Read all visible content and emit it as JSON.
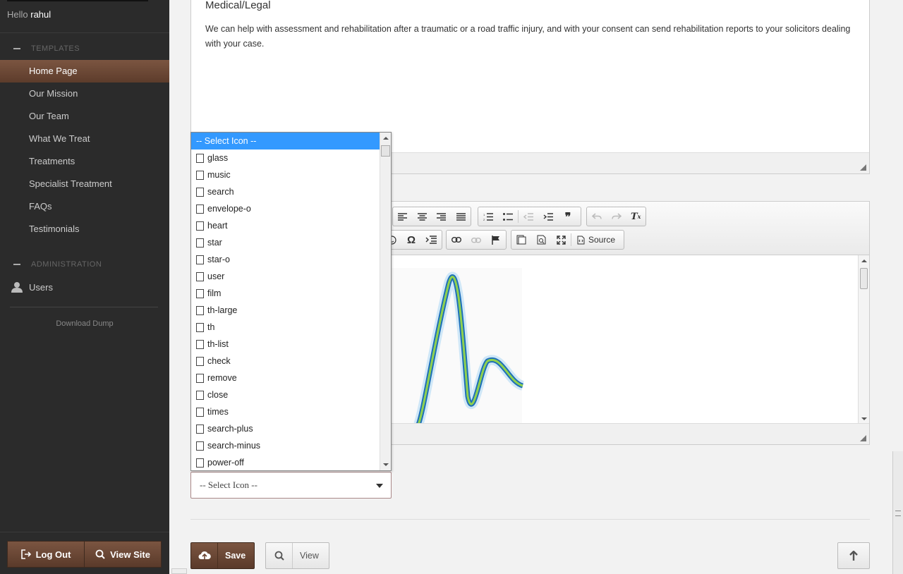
{
  "sidebar": {
    "hello_prefix": "Hello",
    "username": "rahul",
    "templates_heading": "TEMPLATES",
    "items": [
      {
        "label": "Home Page"
      },
      {
        "label": "Our Mission"
      },
      {
        "label": "Our Team"
      },
      {
        "label": "What We Treat"
      },
      {
        "label": "Treatments"
      },
      {
        "label": "Specialist Treatment"
      },
      {
        "label": "FAQs"
      },
      {
        "label": "Testimonials"
      }
    ],
    "admin_heading": "ADMINISTRATION",
    "users_label": "Users",
    "download_label": "Download Dump",
    "logout_label": "Log Out",
    "viewsite_label": "View Site"
  },
  "content": {
    "title": "Medical/Legal",
    "body": "We can help with assessment and rehabilitation after a traumatic or a road traffic injury, and with your consent can send rehabilitation reports to your solicitors dealing with your case."
  },
  "editor": {
    "source_label": "Source"
  },
  "icon_select": {
    "selected": "-- Select Icon --",
    "options": [
      "-- Select Icon --",
      "glass",
      "music",
      "search",
      "envelope-o",
      "heart",
      "star",
      "star-o",
      "user",
      "film",
      "th-large",
      "th",
      "th-list",
      "check",
      "remove",
      "close",
      "times",
      "search-plus",
      "search-minus",
      "power-off"
    ]
  },
  "actions": {
    "save_label": "Save",
    "view_label": "View"
  },
  "colors": {
    "brand_brown": "#6b4634",
    "select_highlight": "#3399ff"
  }
}
